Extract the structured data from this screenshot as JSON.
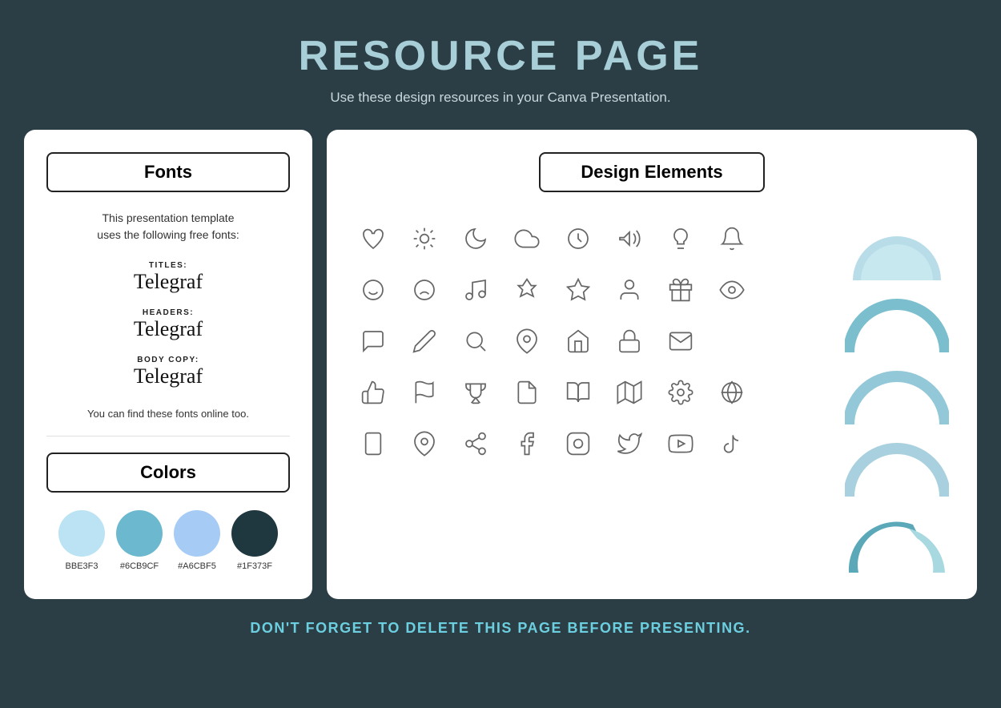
{
  "page": {
    "title": "RESOURCE PAGE",
    "subtitle": "Use these design resources in your Canva Presentation.",
    "footer": "DON'T FORGET TO DELETE THIS PAGE BEFORE PRESENTING."
  },
  "left_panel": {
    "fonts_label": "Fonts",
    "font_description_line1": "This presentation template",
    "font_description_line2": "uses the following free fonts:",
    "titles_label": "TITLES:",
    "titles_font": "Telegraf",
    "headers_label": "HEADERS:",
    "headers_font": "Telegraf",
    "body_label": "BODY COPY:",
    "body_font": "Telegraf",
    "font_note": "You can find these fonts online too.",
    "colors_label": "Colors",
    "swatches": [
      {
        "hex": "#BBE3F3",
        "label": "BBE3F3"
      },
      {
        "hex": "#6CB9CF",
        "label": "#6CB9CF"
      },
      {
        "hex": "#A6CBF5",
        "label": "#A6CBF5"
      },
      {
        "hex": "#1F373F",
        "label": "#1F373F"
      }
    ]
  },
  "right_panel": {
    "design_elements_label": "Design Elements"
  },
  "arc_colors": {
    "fill1": "#a8d8e8",
    "fill2": "#85c5d8",
    "fill3": "#6cb2c8",
    "fill4": "#5aa0b5",
    "fill5": "#4a90a4"
  }
}
